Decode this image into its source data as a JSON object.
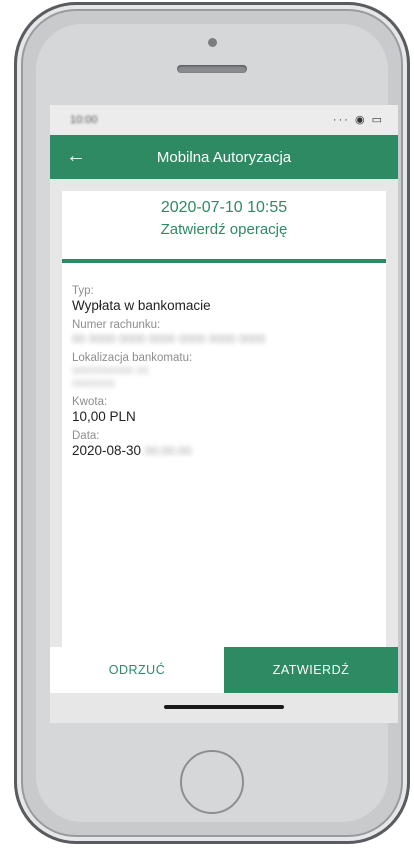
{
  "status": {
    "time": "10:00",
    "icons": "··· ◉ ▭"
  },
  "app_bar": {
    "back_icon": "arrow-left-icon",
    "title": "Mobilna Autoryzacja"
  },
  "operation": {
    "datetime": "2020-07-10 10:55",
    "subtitle": "Zatwierdź operację"
  },
  "fields": {
    "type_label": "Typ:",
    "type_value": "Wypłata w bankomacie",
    "account_label": "Numer rachunku:",
    "account_value": "00 0000 0000 0000 0000 0000 0000",
    "atm_label": "Lokalizacja bankomatu:",
    "atm_line1": "0000000000 00",
    "atm_line2": "0000000",
    "amount_label": "Kwota:",
    "amount_value": "10,00 PLN",
    "date_label": "Data:",
    "date_value": "2020-08-30",
    "date_time_blurred": "00:00:00"
  },
  "actions": {
    "reject": "ODRZUĆ",
    "accept": "ZATWIERDŹ"
  },
  "colors": {
    "brand": "#2e8a63",
    "background": "#e7e7e7"
  }
}
